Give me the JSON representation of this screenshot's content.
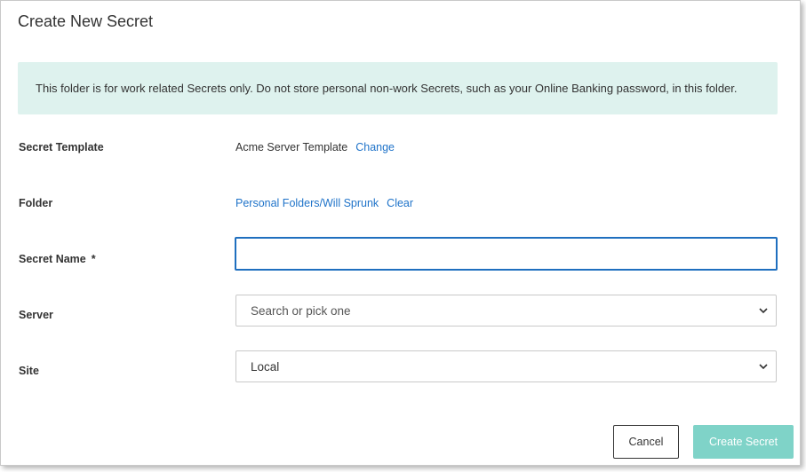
{
  "dialog": {
    "title": "Create New Secret",
    "notice": "This folder is for work related Secrets only. Do not store personal non-work Secrets, such as your Online Banking password, in this folder."
  },
  "form": {
    "template": {
      "label": "Secret Template",
      "value": "Acme Server Template",
      "action": "Change"
    },
    "folder": {
      "label": "Folder",
      "value": "Personal Folders/Will Sprunk",
      "action": "Clear"
    },
    "secret_name": {
      "label": "Secret Name",
      "required_mark": "*",
      "value": "",
      "placeholder": ""
    },
    "server": {
      "label": "Server",
      "placeholder": "Search or pick one",
      "chevron_icon": "chevron-down-icon"
    },
    "site": {
      "label": "Site",
      "selected": "Local",
      "chevron_icon": "chevron-down-icon"
    }
  },
  "buttons": {
    "cancel": "Cancel",
    "create": "Create Secret"
  },
  "colors": {
    "notice_bg": "#def2ee",
    "link": "#1f73c9",
    "focus_border": "#1f6fbf",
    "primary_disabled": "#7fd3c8"
  }
}
